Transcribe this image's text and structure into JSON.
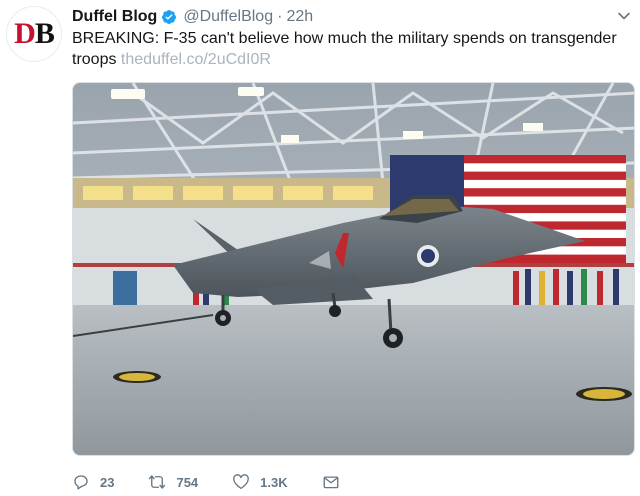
{
  "tweet": {
    "avatar_text": "DB",
    "author_name": "Duffel Blog",
    "verified_icon": "verified-badge-icon",
    "handle": "@DuffelBlog",
    "separator": "·",
    "timestamp": "22h",
    "body_text": "BREAKING: F-35 can't believe how much the military spends on transgender troops ",
    "link_text": "theduffel.co/2uCdI0R",
    "media_description_icon": "photo-f35-in-hangar",
    "colors": {
      "link": "#a9b4bd",
      "verified": "#1da1f2",
      "secondary_text": "#657786",
      "avatar_accent": "#c8102e"
    }
  },
  "actions": {
    "reply_count": "23",
    "retweet_count": "754",
    "like_count": "1.3K",
    "reply_icon": "reply-icon",
    "retweet_icon": "retweet-icon",
    "like_icon": "heart-icon",
    "message_icon": "envelope-icon"
  }
}
